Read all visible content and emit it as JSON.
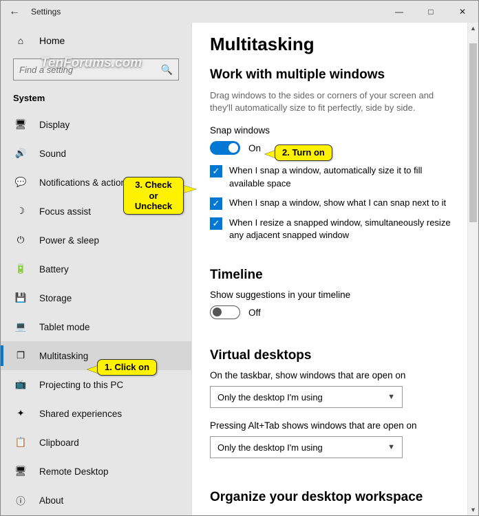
{
  "window": {
    "title": "Settings"
  },
  "watermark": "TenForums.com",
  "sidebar": {
    "home_label": "Home",
    "search_placeholder": "Find a setting",
    "section_label": "System",
    "items": [
      {
        "label": "Display",
        "icon": "display-icon"
      },
      {
        "label": "Sound",
        "icon": "sound-icon"
      },
      {
        "label": "Notifications & actions",
        "icon": "notifications-icon"
      },
      {
        "label": "Focus assist",
        "icon": "focus-assist-icon"
      },
      {
        "label": "Power & sleep",
        "icon": "power-icon"
      },
      {
        "label": "Battery",
        "icon": "battery-icon"
      },
      {
        "label": "Storage",
        "icon": "storage-icon"
      },
      {
        "label": "Tablet mode",
        "icon": "tablet-icon"
      },
      {
        "label": "Multitasking",
        "icon": "multitasking-icon",
        "selected": true
      },
      {
        "label": "Projecting to this PC",
        "icon": "projecting-icon"
      },
      {
        "label": "Shared experiences",
        "icon": "shared-icon"
      },
      {
        "label": "Clipboard",
        "icon": "clipboard-icon"
      },
      {
        "label": "Remote Desktop",
        "icon": "remote-desktop-icon"
      },
      {
        "label": "About",
        "icon": "about-icon"
      }
    ]
  },
  "main": {
    "heading": "Multitasking",
    "snap_section": {
      "title": "Work with multiple windows",
      "description": "Drag windows to the sides or corners of your screen and they'll automatically size to fit perfectly, side by side.",
      "toggle_label": "Snap windows",
      "toggle_on": true,
      "toggle_state_text": "On",
      "checks": [
        "When I snap a window, automatically size it to fill available space",
        "When I snap a window, show what I can snap next to it",
        "When I resize a snapped window, simultaneously resize any adjacent snapped window"
      ]
    },
    "timeline_section": {
      "title": "Timeline",
      "toggle_label": "Show suggestions in your timeline",
      "toggle_on": false,
      "toggle_state_text": "Off"
    },
    "virtual_section": {
      "title": "Virtual desktops",
      "taskbar_label": "On the taskbar, show windows that are open on",
      "taskbar_value": "Only the desktop I'm using",
      "alttab_label": "Pressing Alt+Tab shows windows that are open on",
      "alttab_value": "Only the desktop I'm using"
    },
    "organize_section": {
      "title": "Organize your desktop workspace"
    }
  },
  "callouts": {
    "c1": "1. Click on",
    "c2": "2. Turn on",
    "c3": "3. Check or Uncheck"
  }
}
